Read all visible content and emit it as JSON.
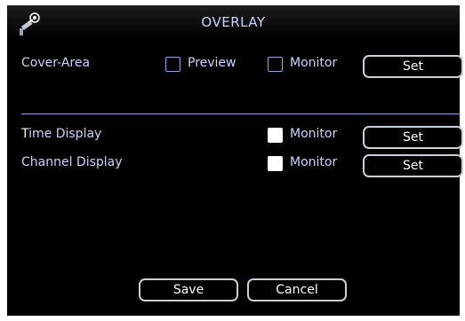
{
  "window": {
    "title": "OVERLAY",
    "app_icon": "satellite-camera-icon"
  },
  "cover_area": {
    "label": "Cover-Area",
    "preview_label": "Preview",
    "preview_checked": false,
    "monitor_label": "Monitor",
    "monitor_checked": false,
    "set_label": "Set"
  },
  "time_display": {
    "label_first": "T",
    "label_rest": "ime Display",
    "monitor_label": "Monitor",
    "monitor_checked": true,
    "set_label": "Set"
  },
  "channel_display": {
    "label": "Channel Display",
    "monitor_label": "Monitor",
    "monitor_checked": true,
    "set_label": "Set"
  },
  "footer": {
    "save_label": "Save",
    "cancel_label": "Cancel"
  },
  "colors": {
    "background": "#000000",
    "text": "#c8d4ff",
    "button_border": "#c7cfdb"
  }
}
